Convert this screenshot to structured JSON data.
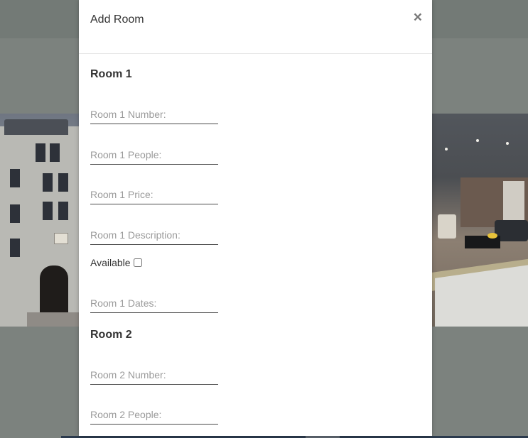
{
  "modal": {
    "title": "Add Room",
    "close_label": "×"
  },
  "rooms": [
    {
      "heading": "Room 1",
      "number_placeholder": "Room 1 Number:",
      "people_placeholder": "Room 1 People:",
      "price_placeholder": "Room 1 Price:",
      "description_placeholder": "Room 1 Description:",
      "available_label": "Available",
      "available_checked": false,
      "dates_placeholder": "Room 1 Dates:"
    },
    {
      "heading": "Room 2",
      "number_placeholder": "Room 2 Number:",
      "people_placeholder": "Room 2 People:"
    }
  ],
  "colors": {
    "overlay": "#7c827e",
    "modal_bg": "#ffffff",
    "field_underline": "#4a4a4a",
    "placeholder": "#9a9a9a"
  }
}
